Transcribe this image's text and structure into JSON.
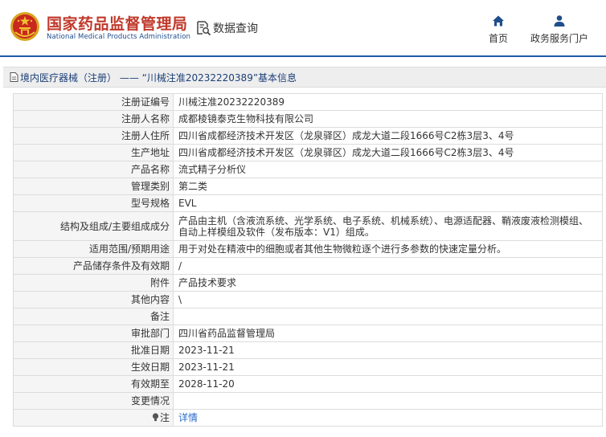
{
  "header": {
    "agency_cn": "国家药品监督管理局",
    "agency_en": "National Medical Products Administration",
    "query_label": "数据查询",
    "nav": {
      "home_label": "首页",
      "portal_label": "政务服务门户"
    }
  },
  "title_bar": {
    "text": "境内医疗器械（注册） —— “川械注准20232220389”基本信息"
  },
  "record": {
    "rows": [
      {
        "label": "注册证编号",
        "value": "川械注准20232220389"
      },
      {
        "label": "注册人名称",
        "value": "成都棱镜泰克生物科技有限公司"
      },
      {
        "label": "注册人住所",
        "value": "四川省成都经济技术开发区（龙泉驿区）成龙大道二段1666号C2栋3层3、4号"
      },
      {
        "label": "生产地址",
        "value": "四川省成都经济技术开发区（龙泉驿区）成龙大道二段1666号C2栋3层3、4号"
      },
      {
        "label": "产品名称",
        "value": "流式精子分析仪"
      },
      {
        "label": "管理类别",
        "value": "第二类"
      },
      {
        "label": "型号规格",
        "value": "EVL"
      },
      {
        "label": "结构及组成/主要组成成分",
        "value": "产品由主机（含液流系统、光学系统、电子系统、机械系统）、电源适配器、鞘液废液检测模组、自动上样模组及软件（发布版本：V1）组成。"
      },
      {
        "label": "适用范围/预期用途",
        "value": "用于对处在精液中的细胞或者其他生物微粒逐个进行多参数的快速定量分析。"
      },
      {
        "label": "产品储存条件及有效期",
        "value": "/"
      },
      {
        "label": "附件",
        "value": "产品技术要求"
      },
      {
        "label": "其他内容",
        "value": "\\"
      },
      {
        "label": "备注",
        "value": ""
      },
      {
        "label": "审批部门",
        "value": "四川省药品监督管理局"
      },
      {
        "label": "批准日期",
        "value": "2023-11-21"
      },
      {
        "label": "生效日期",
        "value": "2023-11-21"
      },
      {
        "label": "有效期至",
        "value": "2028-11-20"
      },
      {
        "label": "变更情况",
        "value": ""
      }
    ],
    "note": {
      "label": "注",
      "link": "详情"
    }
  },
  "colors": {
    "brand_red": "#c0392b",
    "brand_blue": "#1f5aa6",
    "link_blue": "#2a6bcc"
  },
  "icons": {
    "emblem": "national-emblem-icon",
    "query": "document-search-icon",
    "home": "home-icon",
    "portal": "user-icon",
    "title": "document-icon",
    "note": "lightbulb-icon"
  }
}
